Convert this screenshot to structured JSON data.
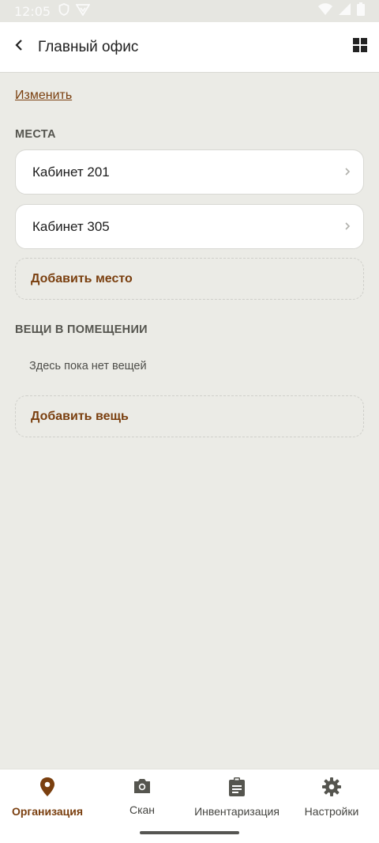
{
  "status_bar": {
    "time": "12:05",
    "icons_left": [
      "shield-icon",
      "vpn-icon"
    ],
    "icons_right": [
      "wifi-icon",
      "signal-icon",
      "battery-icon"
    ]
  },
  "app_bar": {
    "title": "Главный офис",
    "back_icon": "back-arrow-icon",
    "grid_icon": "grid-view-icon"
  },
  "edit_link": "Изменить",
  "places_section": {
    "title": "МЕСТА",
    "items": [
      {
        "label": "Кабинет 201"
      },
      {
        "label": "Кабинет 305"
      }
    ],
    "add_label": "Добавить место"
  },
  "items_section": {
    "title": "ВЕЩИ В ПОМЕЩЕНИИ",
    "empty_text": "Здесь пока нет вещей",
    "add_label": "Добавить вещь"
  },
  "bottom_nav": {
    "items": [
      {
        "label": "Организация",
        "icon": "location-pin-icon",
        "active": true
      },
      {
        "label": "Скан",
        "icon": "camera-icon",
        "active": false
      },
      {
        "label": "Инвентаризация",
        "icon": "clipboard-icon",
        "active": false
      },
      {
        "label": "Настройки",
        "icon": "gear-icon",
        "active": false
      }
    ]
  },
  "colors": {
    "accent": "#7a3f0f",
    "background": "#ebebe6",
    "surface": "#ffffff"
  }
}
